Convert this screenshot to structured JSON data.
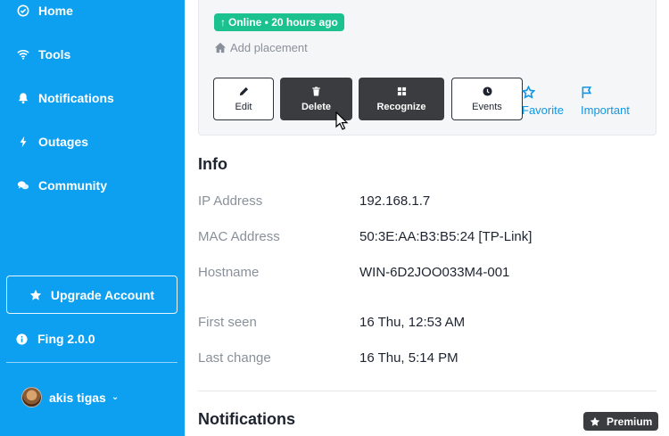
{
  "sidebar": {
    "items": [
      {
        "label": "Home",
        "icon": "home-icon"
      },
      {
        "label": "Tools",
        "icon": "wifi-icon"
      },
      {
        "label": "Notifications",
        "icon": "bell-icon"
      },
      {
        "label": "Outages",
        "icon": "bolt-icon"
      },
      {
        "label": "Community",
        "icon": "chat-icon"
      }
    ],
    "upgrade_label": "Upgrade Account",
    "version": "Fing 2.0.0",
    "user_name": "akis tigas"
  },
  "device": {
    "status": "Online • 20 hours ago",
    "add_placement": "Add placement",
    "actions": {
      "edit": "Edit",
      "delete": "Delete",
      "recognize": "Recognize",
      "events": "Events",
      "favorite": "Favorite",
      "important": "Important"
    }
  },
  "info": {
    "title": "Info",
    "rows": [
      {
        "label": "IP Address",
        "value": "192.168.1.7"
      },
      {
        "label": "MAC Address",
        "value": "50:3E:AA:B3:B5:24 [TP-Link]"
      },
      {
        "label": "Hostname",
        "value": "WIN-6D2JOO033M4-001"
      },
      {
        "label": "First seen",
        "value": "16 Thu, 12:53 AM"
      },
      {
        "label": "Last change",
        "value": "16 Thu, 5:14 PM"
      }
    ]
  },
  "notifications": {
    "title": "Notifications",
    "badge": "Premium"
  },
  "colors": {
    "sidebar": "#0ea0f0",
    "online": "#1bc18f",
    "dark_button": "#3a3c3f",
    "link": "#1296e3"
  }
}
